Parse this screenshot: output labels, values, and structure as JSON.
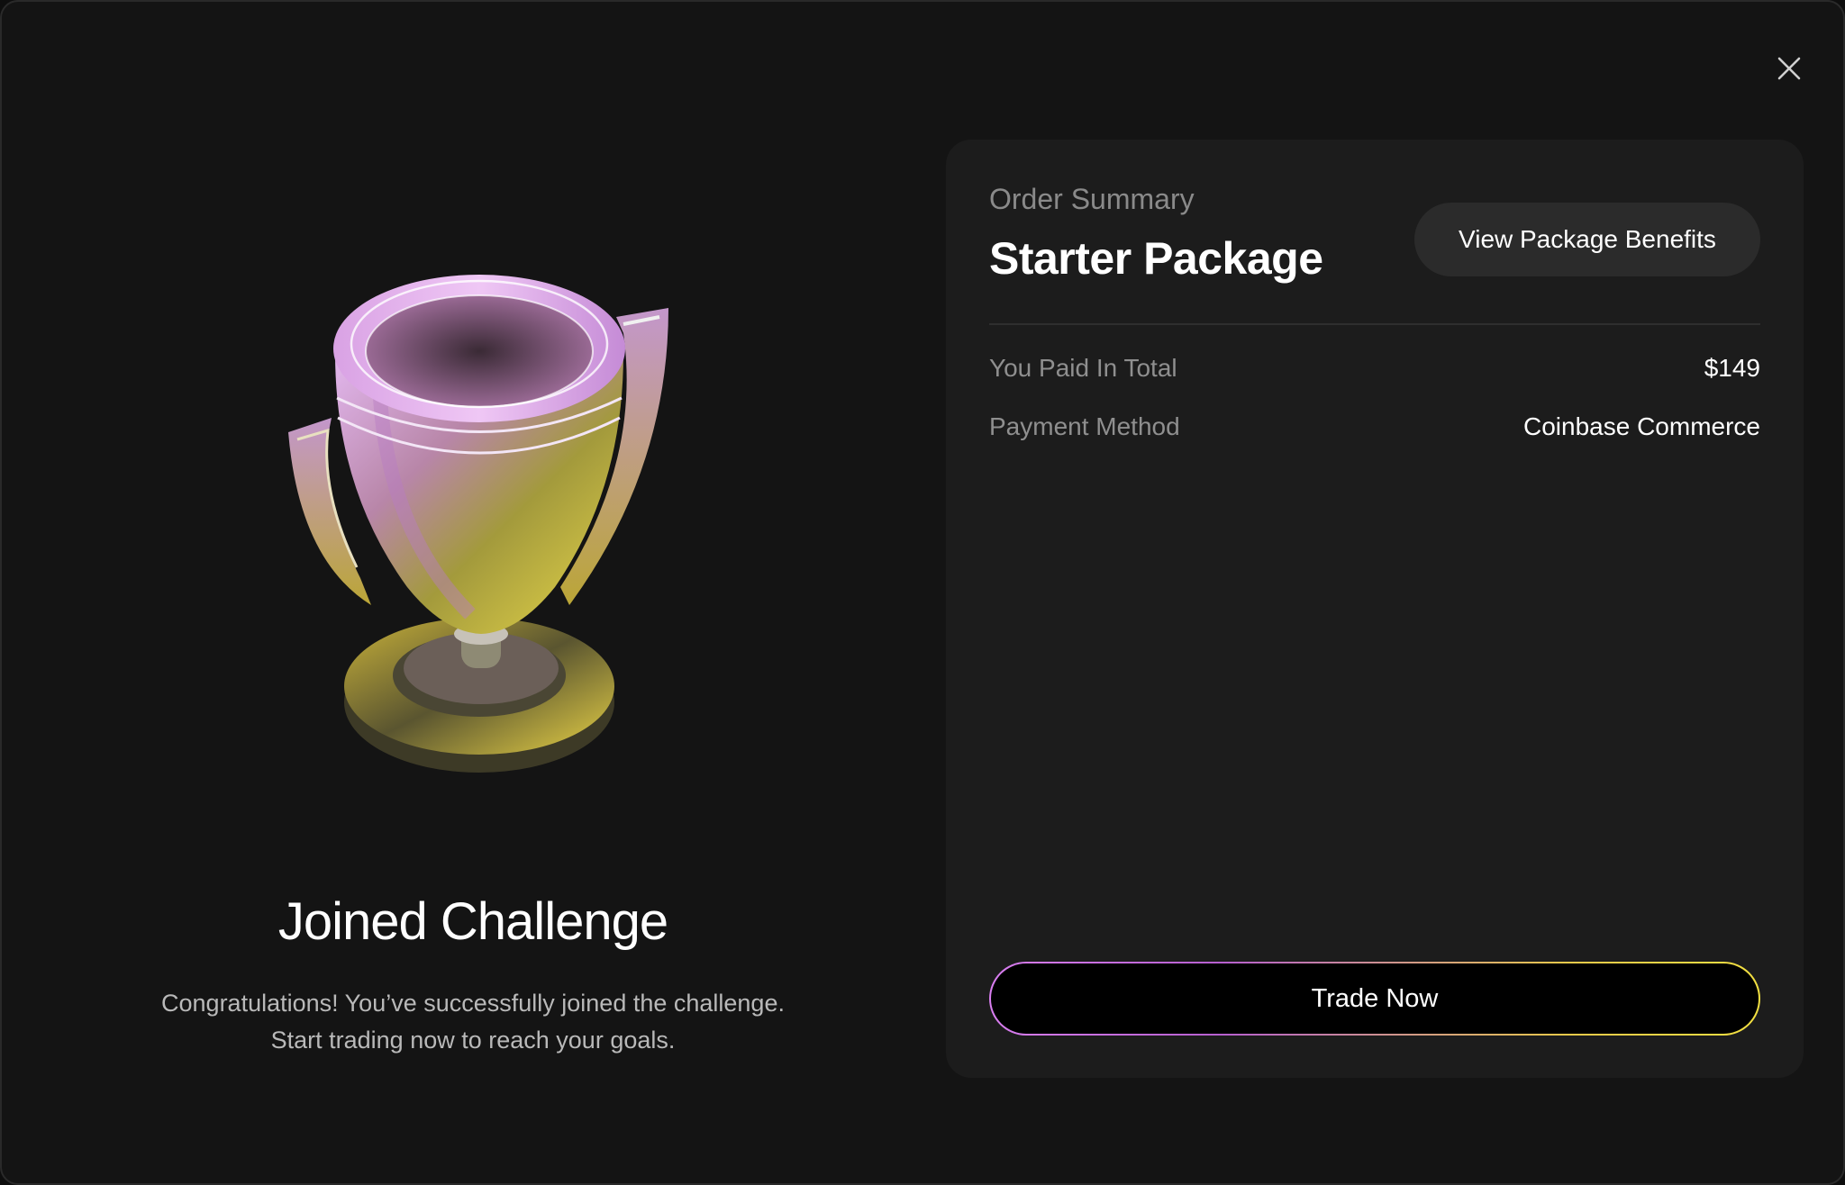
{
  "close": {
    "icon": "close-icon"
  },
  "left": {
    "trophy_icon": "trophy-icon",
    "title": "Joined Challenge",
    "description_line1": "Congratulations! You’ve successfully joined the challenge.",
    "description_line2": "Start trading now to reach your goals."
  },
  "summary": {
    "label": "Order Summary",
    "package_name": "Starter Package",
    "benefits_button": "View Package Benefits",
    "rows": [
      {
        "label": "You Paid In Total",
        "value": "$149"
      },
      {
        "label": "Payment Method",
        "value": "Coinbase Commerce"
      }
    ],
    "cta": "Trade Now"
  },
  "colors": {
    "background": "#141414",
    "card": "#1c1c1c",
    "accent_pink": "#d97ef0",
    "accent_yellow": "#f2e041"
  }
}
